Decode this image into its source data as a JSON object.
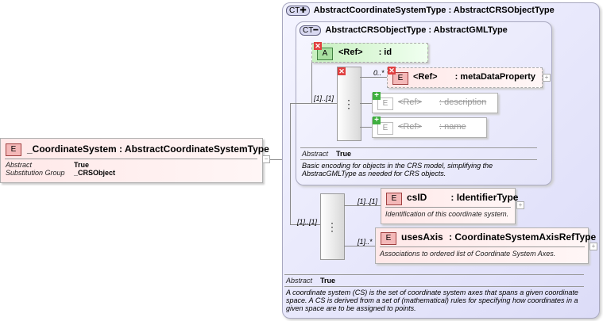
{
  "root": {
    "badge": "E",
    "name": "_CoordinateSystem",
    "type": ": AbstractCoordinateSystemType",
    "props": [
      {
        "label": "Abstract",
        "value": "True"
      },
      {
        "label": "Substitution Group",
        "value": "_CRSObject"
      }
    ]
  },
  "outer_type": {
    "badge": "CT",
    "name": "AbstractCoordinateSystemType",
    "base": ": AbstractCRSObjectType",
    "abstract_label": "Abstract",
    "abstract_value": "True",
    "doc": "A coordinate system (CS) is the set of coordinate system axes that spans a given coordinate space. A CS is derived from a set of (mathematical) rules for specifying how coordinates in a given space are to be assigned to points."
  },
  "inner_type": {
    "badge": "CT",
    "name": "AbstractCRSObjectType",
    "base": ": AbstractGMLType",
    "abstract_label": "Abstract",
    "abstract_value": "True",
    "doc": "Basic encoding for objects in the CRS model, simplifying the AbstracGMLType as needed for CRS objects."
  },
  "attribute": {
    "badge": "A",
    "name": "<Ref>",
    "type": ": id"
  },
  "inner_seq": {
    "cardinality": "[1]..[1]",
    "items": [
      {
        "badge": "E",
        "name": "<Ref>",
        "type": ": metaDataProperty",
        "cardinality": "0..*"
      },
      {
        "badge": "E",
        "name": "<Ref>",
        "type": ": description"
      },
      {
        "badge": "E",
        "name": "<Ref>",
        "type": ": name"
      }
    ]
  },
  "outer_seq": {
    "cardinality": "[1]..[1]",
    "items": [
      {
        "badge": "E",
        "name": "csID",
        "type": ": IdentifierType",
        "cardinality": "[1]..[1]",
        "doc": "Identification of this coordinate system."
      },
      {
        "badge": "E",
        "name": "usesAxis",
        "type": ": CoordinateSystemAxisRefType",
        "cardinality": "[1]..*",
        "doc": "Associations to ordered list of Coordinate System Axes."
      }
    ]
  }
}
